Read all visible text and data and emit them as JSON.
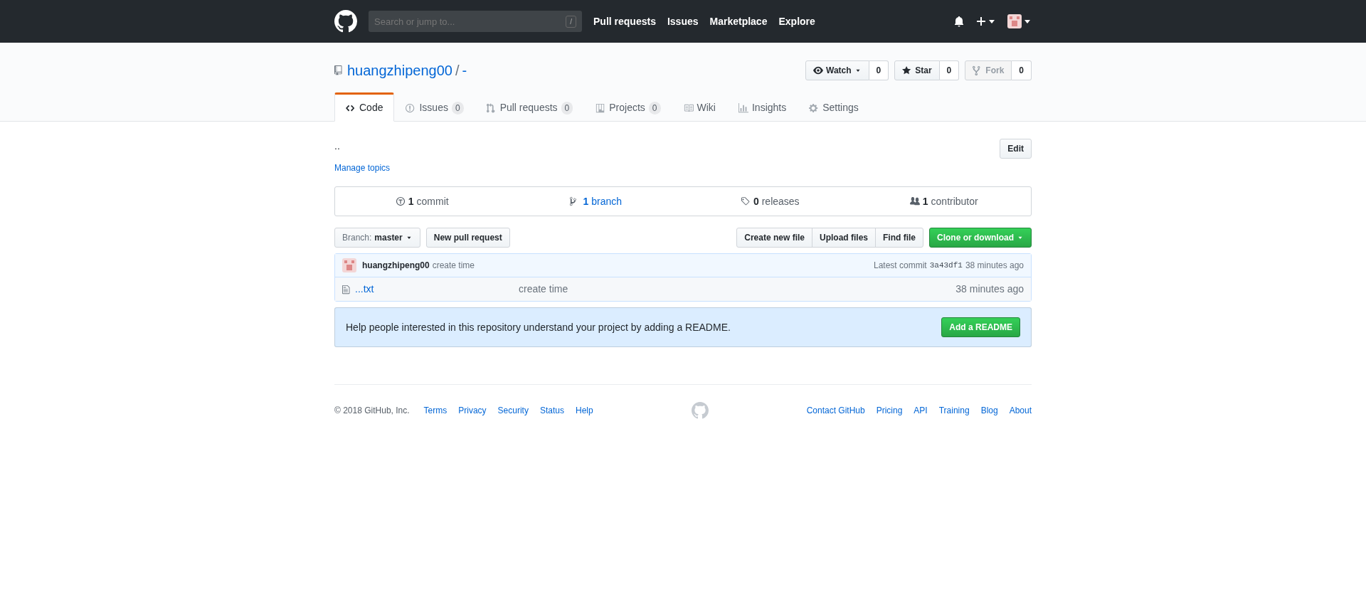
{
  "header": {
    "search": {
      "placeholder": "Search or jump to...",
      "key_hint": "/"
    },
    "nav": [
      "Pull requests",
      "Issues",
      "Marketplace",
      "Explore"
    ]
  },
  "repo": {
    "owner": "huangzhipeng00",
    "separator": "/",
    "name": "-",
    "actions": [
      {
        "label": "Watch",
        "count": "0",
        "disabled": false,
        "dropdown": true
      },
      {
        "label": "Star",
        "count": "0",
        "disabled": false,
        "dropdown": false
      },
      {
        "label": "Fork",
        "count": "0",
        "disabled": true,
        "dropdown": false
      }
    ],
    "tabs": [
      {
        "label": "Code",
        "selected": true
      },
      {
        "label": "Issues",
        "count": "0",
        "selected": false
      },
      {
        "label": "Pull requests",
        "count": "0",
        "selected": false
      },
      {
        "label": "Projects",
        "count": "0",
        "selected": false
      },
      {
        "label": "Wiki",
        "selected": false
      },
      {
        "label": "Insights",
        "selected": false
      },
      {
        "label": "Settings",
        "selected": false
      }
    ]
  },
  "description": "..",
  "edit_button": "Edit",
  "manage_topics": "Manage topics",
  "summary": [
    {
      "number": "1",
      "label": "commit",
      "link": false
    },
    {
      "number": "1",
      "label": "branch",
      "link": true
    },
    {
      "number": "0",
      "label": "releases",
      "link": false
    },
    {
      "number": "1",
      "label": "contributor",
      "link": false
    }
  ],
  "branch": {
    "prefix": "Branch:",
    "value": "master"
  },
  "new_pull_request": "New pull request",
  "file_buttons": [
    "Create new file",
    "Upload files",
    "Find file"
  ],
  "clone_button": "Clone or download",
  "commit": {
    "author": "huangzhipeng00",
    "message": "create time",
    "latest_label": "Latest commit",
    "sha": "3a43df1",
    "time": "38 minutes ago"
  },
  "files": [
    {
      "name": "...txt",
      "message": "create time",
      "age": "38 minutes ago"
    }
  ],
  "readme_notice": {
    "text": "Help people interested in this repository understand your project by adding a README.",
    "button": "Add a README"
  },
  "footer": {
    "copyright": "© 2018 GitHub, Inc.",
    "left_links": [
      "Terms",
      "Privacy",
      "Security",
      "Status",
      "Help"
    ],
    "right_links": [
      "Contact GitHub",
      "Pricing",
      "API",
      "Training",
      "Blog",
      "About"
    ]
  }
}
